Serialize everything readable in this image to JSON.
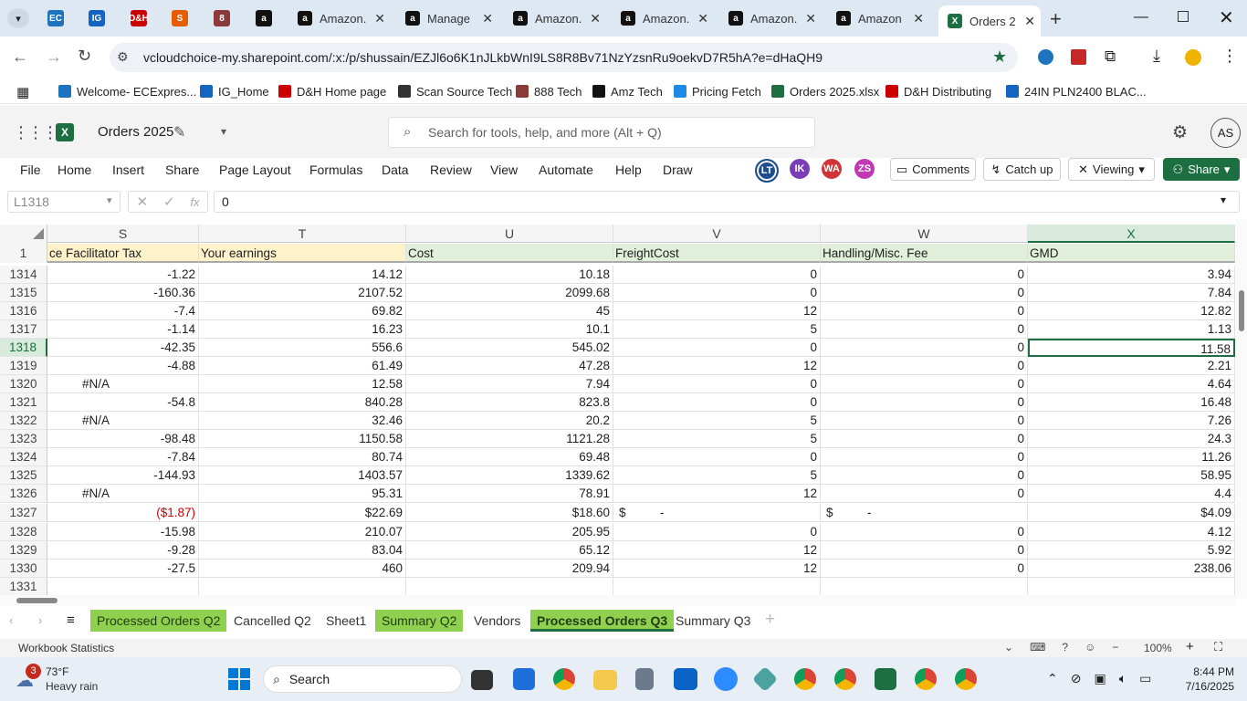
{
  "browser": {
    "pinned_tabs": [
      {
        "icon": "ec-icon",
        "color": "#1e73be",
        "label": "EC"
      },
      {
        "icon": "ig-icon",
        "color": "#1565c0",
        "label": "IG"
      },
      {
        "icon": "dh-icon",
        "color": "#c00",
        "label": "D&H"
      },
      {
        "icon": "scansource-icon",
        "color": "#e65c00",
        "label": "S"
      },
      {
        "icon": "888-icon",
        "color": "#8b3a3a",
        "label": "8"
      },
      {
        "icon": "amazon-icon",
        "color": "#111",
        "label": "a"
      }
    ],
    "tabs": [
      {
        "title": "Amazon.",
        "icon": "a"
      },
      {
        "title": "Manage",
        "icon": "a"
      },
      {
        "title": "Amazon.",
        "icon": "a"
      },
      {
        "title": "Amazon.",
        "icon": "a"
      },
      {
        "title": "Amazon.",
        "icon": "a"
      },
      {
        "title": "Amazon",
        "icon": "a"
      },
      {
        "title": "Orders 2",
        "icon": "X"
      }
    ],
    "url": "vcloudchoice-my.sharepoint.com/:x:/p/shussain/EZJl6o6K1nJLkbWnI9LS8R8Bv71NzYzsnRu9oekvD7R5hA?e=dHaQH9",
    "bookmarks": [
      {
        "label": "Welcome- ECExpres...",
        "color": "#1e73be"
      },
      {
        "label": "IG_Home",
        "color": "#1565c0"
      },
      {
        "label": "D&H Home page",
        "color": "#c00"
      },
      {
        "label": "Scan Source Tech",
        "color": "#333"
      },
      {
        "label": "888 Tech",
        "color": "#8b3a3a"
      },
      {
        "label": "Amz Tech",
        "color": "#111"
      },
      {
        "label": "Pricing Fetch",
        "color": "#1e88e5"
      },
      {
        "label": "Orders 2025.xlsx",
        "color": "#1d6f42"
      },
      {
        "label": "D&H Distributing",
        "color": "#c00"
      },
      {
        "label": "24IN PLN2400 BLAC...",
        "color": "#1565c0"
      }
    ]
  },
  "excel": {
    "title": "Orders 2025",
    "search_placeholder": "Search for tools, help, and more (Alt + Q)",
    "avatar": "AS",
    "menu": [
      "File",
      "Home",
      "Insert",
      "Share",
      "Page Layout",
      "Formulas",
      "Data",
      "Review",
      "View",
      "Automate",
      "Help",
      "Draw"
    ],
    "collaborators": [
      {
        "initials": "LT",
        "color": "#1f4e8c"
      },
      {
        "initials": "IK",
        "color": "#7a3db8"
      },
      {
        "initials": "WA",
        "color": "#d13438"
      },
      {
        "initials": "ZS",
        "color": "#c239b3"
      }
    ],
    "comments_label": "Comments",
    "catchup_label": "Catch up",
    "viewing_label": "Viewing",
    "share_label": "Share",
    "name_box": "L1318",
    "formula_value": "0",
    "fx_label": "fx",
    "columns": [
      "S",
      "T",
      "U",
      "V",
      "W",
      "X"
    ],
    "header_row_number": "1",
    "headers": [
      "ce Facilitator Tax",
      "Your earnings",
      "Cost",
      "FreightCost",
      "Handling/Misc. Fee",
      "GMD"
    ],
    "rows": [
      {
        "n": "1314",
        "c": [
          "-1.22",
          "14.12",
          "10.18",
          "0",
          "0",
          "3.94"
        ]
      },
      {
        "n": "1315",
        "c": [
          "-160.36",
          "2107.52",
          "2099.68",
          "0",
          "0",
          "7.84"
        ]
      },
      {
        "n": "1316",
        "c": [
          "-7.4",
          "69.82",
          "45",
          "12",
          "0",
          "12.82"
        ]
      },
      {
        "n": "1317",
        "c": [
          "-1.14",
          "16.23",
          "10.1",
          "5",
          "0",
          "1.13"
        ]
      },
      {
        "n": "1318",
        "c": [
          "-42.35",
          "556.6",
          "545.02",
          "0",
          "0",
          "11.58"
        ]
      },
      {
        "n": "1319",
        "c": [
          "-4.88",
          "61.49",
          "47.28",
          "12",
          "0",
          "2.21"
        ]
      },
      {
        "n": "1320",
        "c": [
          "#N/A",
          "12.58",
          "7.94",
          "0",
          "0",
          "4.64"
        ]
      },
      {
        "n": "1321",
        "c": [
          "-54.8",
          "840.28",
          "823.8",
          "0",
          "0",
          "16.48"
        ]
      },
      {
        "n": "1322",
        "c": [
          "#N/A",
          "32.46",
          "20.2",
          "5",
          "0",
          "7.26"
        ]
      },
      {
        "n": "1323",
        "c": [
          "-98.48",
          "1150.58",
          "1121.28",
          "5",
          "0",
          "24.3"
        ]
      },
      {
        "n": "1324",
        "c": [
          "-7.84",
          "80.74",
          "69.48",
          "0",
          "0",
          "11.26"
        ]
      },
      {
        "n": "1325",
        "c": [
          "-144.93",
          "1403.57",
          "1339.62",
          "5",
          "0",
          "58.95"
        ]
      },
      {
        "n": "1326",
        "c": [
          "#N/A",
          "95.31",
          "78.91",
          "12",
          "0",
          "4.4"
        ]
      },
      {
        "n": "1327",
        "c": [
          "($1.87)",
          "$22.69",
          "$18.60",
          "$          -",
          "$          -",
          "$4.09"
        ]
      },
      {
        "n": "1328",
        "c": [
          "-15.98",
          "210.07",
          "205.95",
          "0",
          "0",
          "4.12"
        ]
      },
      {
        "n": "1329",
        "c": [
          "-9.28",
          "83.04",
          "65.12",
          "12",
          "0",
          "5.92"
        ]
      },
      {
        "n": "1330",
        "c": [
          "-27.5",
          "460",
          "209.94",
          "12",
          "0",
          "238.06"
        ]
      },
      {
        "n": "1331",
        "c": [
          "",
          "",
          "",
          "",
          "",
          ""
        ]
      }
    ],
    "sheets": [
      {
        "name": "Processed Orders Q2",
        "green": true
      },
      {
        "name": "Cancelled Q2",
        "green": false
      },
      {
        "name": "Sheet1",
        "green": false
      },
      {
        "name": "Summary Q2",
        "green": true
      },
      {
        "name": "Vendors",
        "green": false
      },
      {
        "name": "Processed Orders Q3",
        "green": true,
        "active": true
      },
      {
        "name": "Summary Q3",
        "green": false
      }
    ],
    "status_left": "Workbook Statistics",
    "zoom": "100%"
  },
  "taskbar": {
    "weather_temp": "73°F",
    "weather_desc": "Heavy rain",
    "weather_badge": "3",
    "search_label": "Search",
    "time": "8:44 PM",
    "date": "7/16/2025"
  }
}
